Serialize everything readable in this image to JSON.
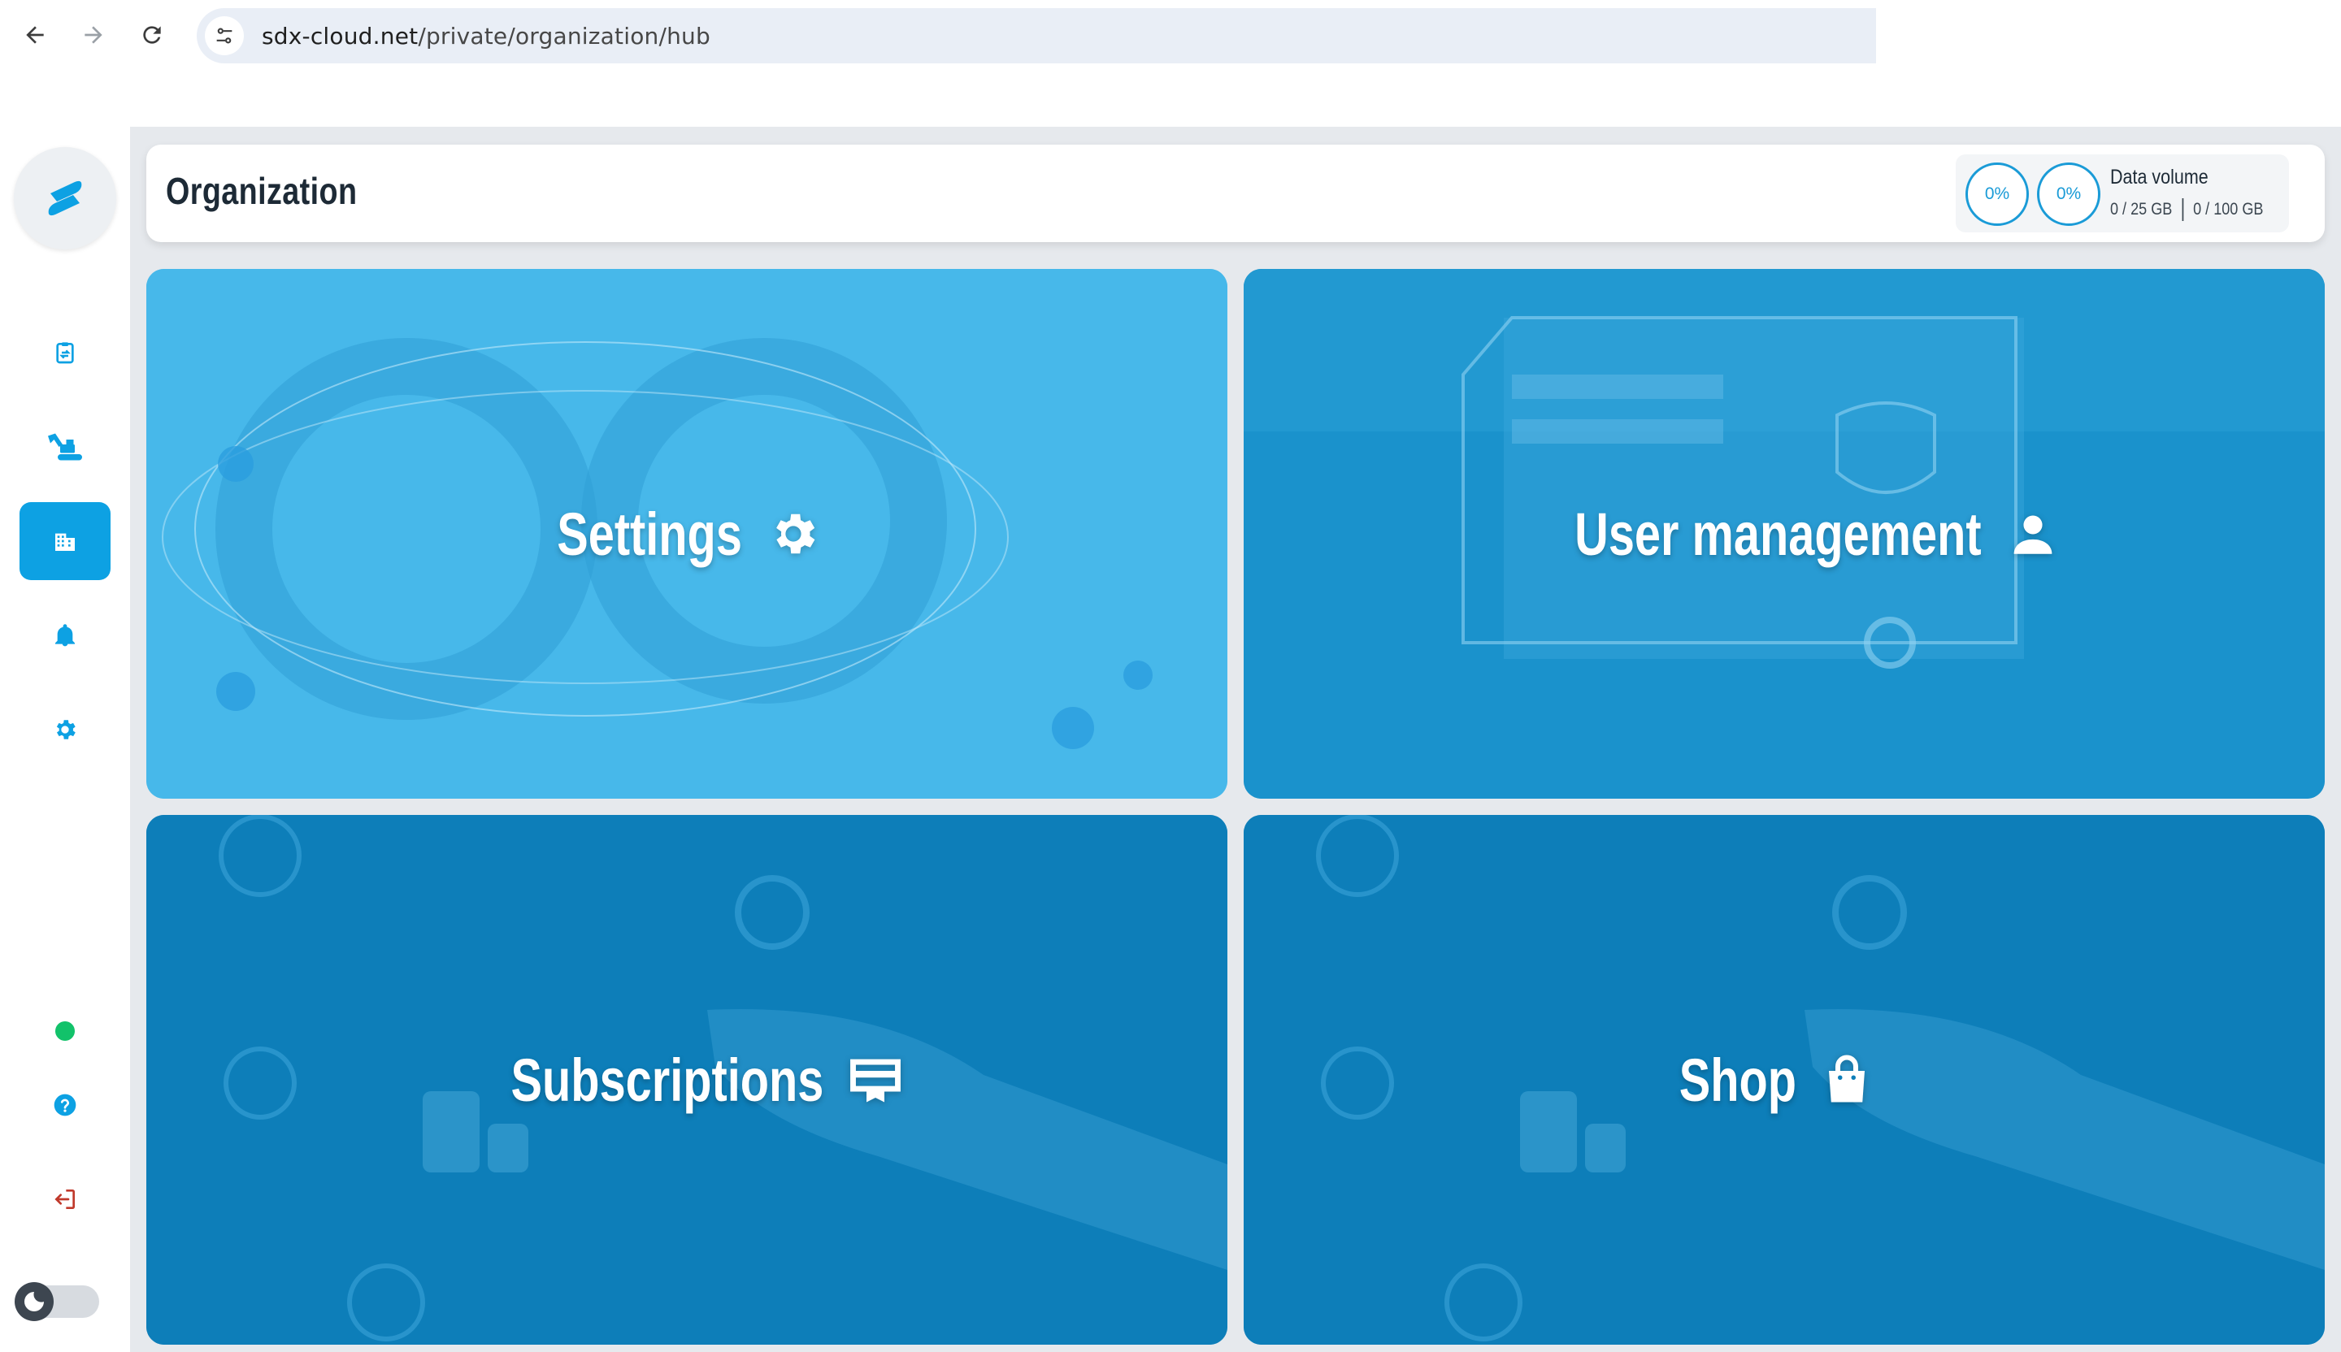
{
  "browser": {
    "url_host": "sdx-cloud.net",
    "url_path": "/private/organization/hub"
  },
  "sidebar": {
    "items": [
      {
        "name": "clipboard-sync",
        "icon": "clipboard-sync-icon",
        "active": false
      },
      {
        "name": "excavator",
        "icon": "excavator-icon",
        "active": false
      },
      {
        "name": "organization",
        "icon": "building-icon",
        "active": true
      },
      {
        "name": "notifications",
        "icon": "bell-icon",
        "active": false
      },
      {
        "name": "settings",
        "icon": "gear-icon",
        "active": false
      }
    ],
    "bottom": [
      {
        "name": "status",
        "icon": "status-dot",
        "color": "#12c26a"
      },
      {
        "name": "help",
        "icon": "help-icon"
      },
      {
        "name": "logout",
        "icon": "logout-icon"
      },
      {
        "name": "theme-toggle",
        "icon": "moon-icon"
      }
    ]
  },
  "header": {
    "title": "Organization",
    "data_volume": {
      "gauge_1": "0%",
      "gauge_2": "0%",
      "label": "Data volume",
      "storage_used": "0 / 25 GB",
      "transfer_used": "0 / 100 GB"
    }
  },
  "tiles": [
    {
      "label": "Settings",
      "icon": "gear-icon"
    },
    {
      "label": "User management",
      "icon": "user-icon"
    },
    {
      "label": "Subscriptions",
      "icon": "card-icon"
    },
    {
      "label": "Shop",
      "icon": "shopping-bag-icon"
    }
  ],
  "colors": {
    "accent": "#0da1e3",
    "logout": "#c0392b",
    "tile_settings": "#47b8ea",
    "tile_users": "#1a92cc",
    "tile_subscriptions": "#0d7eb9",
    "tile_shop": "#0d7eb9"
  }
}
